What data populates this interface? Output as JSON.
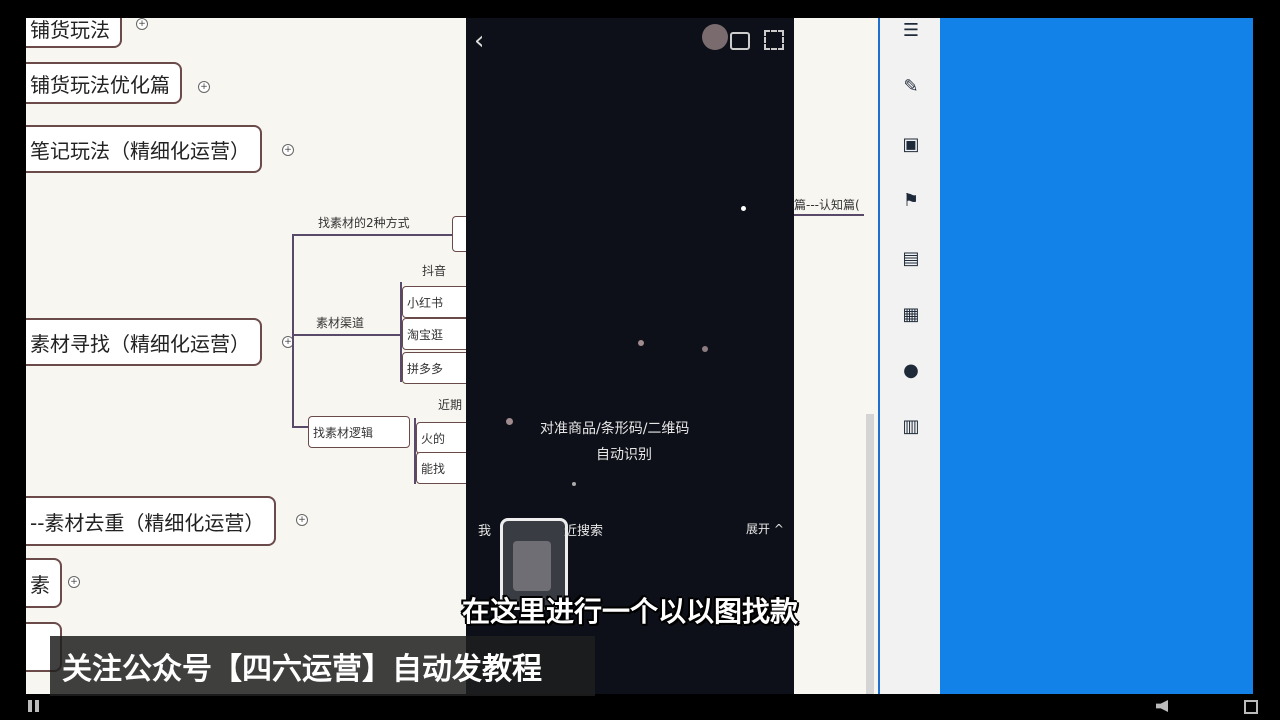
{
  "mindmap": {
    "nodes": [
      "铺货玩法",
      "铺货玩法优化篇",
      "笔记玩法（精细化运营）",
      "素材寻找（精细化运营）",
      "--素材去重（精细化运营）",
      "素"
    ],
    "sub_labels": {
      "find_two_ways": "找素材的2种方式",
      "channels": "素材渠道",
      "douyin": "抖音",
      "xiaohongshu": "小红书",
      "taobao": "淘宝逛",
      "pinduoduo": "拼多多",
      "find_logic": "找素材逻辑",
      "recent": "近期",
      "hot": "火的",
      "can_find": "能找"
    }
  },
  "phone": {
    "back_glyph": "‹",
    "scan_hint_line1": "对准商品/条形码/二维码",
    "scan_hint_line2": "自动识别",
    "bottom_left": "我",
    "recent_search": "近搜索",
    "expand": "展开 ^"
  },
  "rightdoc": {
    "fragment": "篇---认知篇("
  },
  "toolbar": {
    "icons": [
      "list-tree-icon",
      "brush-icon",
      "image-icon",
      "flag-icon",
      "keyboard-icon",
      "document-icon",
      "chat-icon",
      "clipboard-icon"
    ]
  },
  "overlay": {
    "subtitle": "在这里进行一个以以图找款",
    "banner": "关注公众号【四六运营】自动发教程"
  },
  "colors": {
    "accent_blue": "#1282e8",
    "phone_bg": "#0d1018",
    "node_border": "#6b4a4a"
  }
}
